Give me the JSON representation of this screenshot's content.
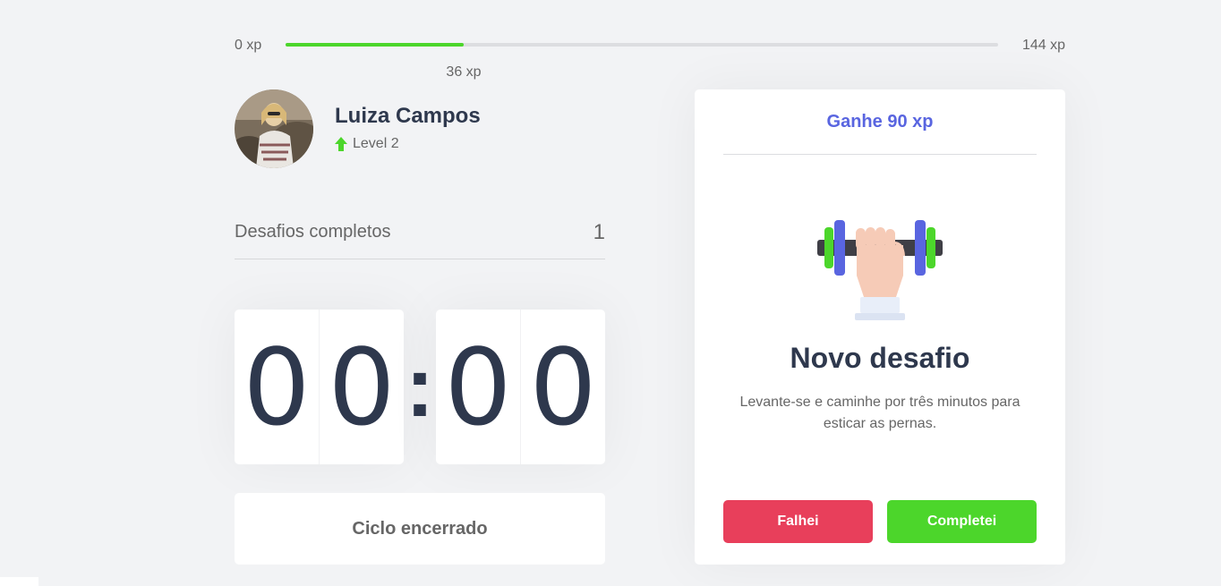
{
  "experience": {
    "min_label": "0 xp",
    "max_label": "144 xp",
    "current_label": "36 xp",
    "current": 36,
    "max": 144,
    "fill_color": "#4cd62b"
  },
  "profile": {
    "name": "Luiza Campos",
    "level_label": "Level 2",
    "level_icon": "level-up-arrow-icon"
  },
  "completed_challenges": {
    "label": "Desafios completos",
    "value": "1"
  },
  "countdown": {
    "minute_digits": [
      "0",
      "0"
    ],
    "separator": ":",
    "second_digits": [
      "0",
      "0"
    ]
  },
  "cycle_button": {
    "label": "Ciclo encerrado"
  },
  "challenge": {
    "header": "Ganhe 90 xp",
    "icon": "dumbbell-icon",
    "title": "Novo desafio",
    "description": "Levante-se e caminhe por três minutos para esticar as pernas.",
    "fail_label": "Falhei",
    "complete_label": "Completei"
  },
  "colors": {
    "accent": "#5965e0",
    "success": "#4cd62b",
    "danger": "#e83f5b",
    "title": "#2e384d",
    "text": "#666666"
  }
}
